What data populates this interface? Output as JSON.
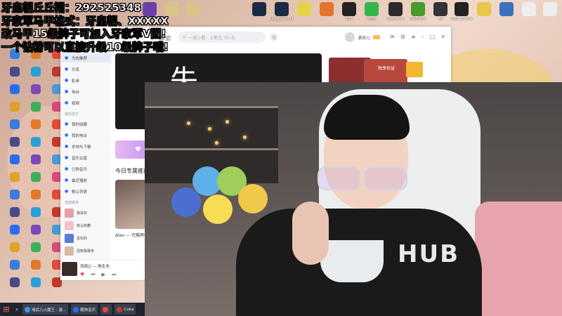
{
  "overlay": {
    "line1": "牙皇朝丘丘裙：292525348",
    "line2": "牙家军马甲格式：牙皇朝、XXXXX",
    "line3": "改马甲15级牌子可加入牙家军V团!",
    "line4": "一个钻粉可以直接升级10级牌子哦!"
  },
  "music_app": {
    "search_label": "探索",
    "search_placeholder": "一周小圆 · 上新在 TO·水",
    "user_name": "涌岳儿",
    "sidebar": {
      "items": [
        {
          "icon": "home-icon",
          "label": "为你推荐"
        },
        {
          "icon": "music-icon",
          "label": "乐库"
        },
        {
          "icon": "video-icon",
          "label": "影审"
        },
        {
          "icon": "radio-icon",
          "label": "电台"
        },
        {
          "icon": "video-icon",
          "label": "视频"
        }
      ],
      "my_music_heading": "我的音乐",
      "my_items": [
        {
          "icon": "heart-icon",
          "label": "我的收藏"
        },
        {
          "icon": "clock-icon",
          "label": "我的电台"
        },
        {
          "icon": "download-icon",
          "label": "本地与下载"
        },
        {
          "icon": "cloud-icon",
          "label": "音乐云盘"
        },
        {
          "icon": "bought-icon",
          "label": "已购音乐"
        },
        {
          "icon": "history-icon",
          "label": "最近播放"
        },
        {
          "icon": "list-icon",
          "label": "默认列表"
        }
      ],
      "playlist_heading": "自建歌单",
      "playlists": [
        {
          "name": "我喜欢",
          "color": "#e8a0a6"
        },
        {
          "name": "默认收藏",
          "color": "#f2c3c8"
        },
        {
          "name": "喜欢的",
          "color": "#5b7bd8"
        },
        {
          "name": "回到我歌单",
          "color": "#d8b9a6"
        }
      ]
    },
    "main": {
      "banner_char": "失",
      "section_title": "今日专属推荐",
      "song_caption": "Alan — 代推荐荐"
    },
    "promo": {
      "label": "独享权益"
    },
    "player": {
      "title": "流浪心 — 陈生先"
    }
  },
  "desktop_icons_top": [
    {
      "label": "",
      "color": "#6d3fa8",
      "icon": "app-icon"
    },
    {
      "label": "",
      "color": "#d8c48a",
      "icon": "file-icon"
    },
    {
      "label": "",
      "color": "#d8c48a",
      "icon": "file-icon"
    },
    {
      "label": "",
      "color": "#1a2a44",
      "icon": "steam-icon"
    },
    {
      "label": "League of Legends",
      "color": "#1a2a44",
      "icon": "game-icon"
    },
    {
      "label": "",
      "color": "#e5d24a",
      "icon": "app-icon"
    },
    {
      "label": "",
      "color": "#e5732e",
      "icon": "app-icon"
    },
    {
      "label": "QQ",
      "color": "#222",
      "icon": "qq-icon"
    },
    {
      "label": "微信",
      "color": "#34b54a",
      "icon": "wechat-icon"
    },
    {
      "label": "WeGame",
      "color": "#2a2a2a",
      "icon": "game-icon"
    },
    {
      "label": "GeForce",
      "color": "#4a9a2a",
      "icon": "app-icon"
    },
    {
      "label": "4K",
      "color": "#333",
      "icon": "app-icon"
    },
    {
      "label": "OBS Studio",
      "color": "#222",
      "icon": "obs-icon"
    },
    {
      "label": "",
      "color": "#e6c84a",
      "icon": "app-icon"
    },
    {
      "label": "",
      "color": "#3e6fbf",
      "icon": "app-icon"
    },
    {
      "label": "",
      "color": "#eee",
      "icon": "file-icon"
    },
    {
      "label": "",
      "color": "#eee",
      "icon": "file-icon"
    }
  ],
  "taskbar": {
    "apps": [
      {
        "label": "魂武儿火魔王 - 激...",
        "color": "#4a8fe8",
        "icon": "browser-icon"
      },
      {
        "label": "酷狗音乐",
        "color": "#2a6df4",
        "icon": "music-icon"
      },
      {
        "label": "",
        "color": "#e04a3a",
        "icon": "app-icon"
      },
      {
        "label": "Cuba",
        "color": "#c03a3a",
        "icon": "app-icon"
      }
    ]
  }
}
